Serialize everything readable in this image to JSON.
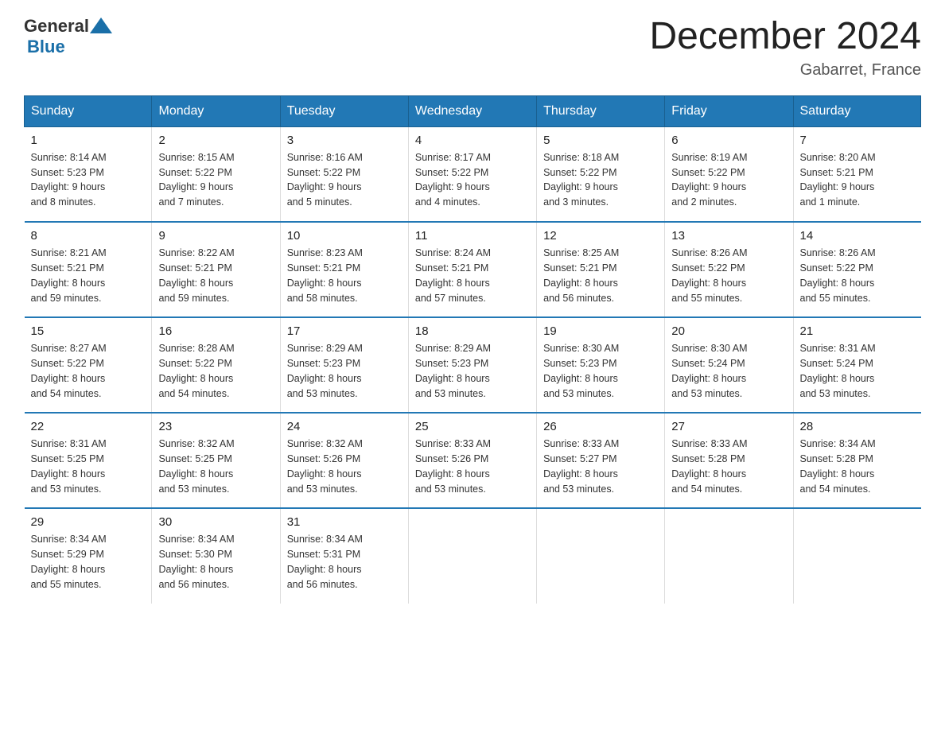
{
  "header": {
    "logo_general": "General",
    "logo_blue": "Blue",
    "month_title": "December 2024",
    "location": "Gabarret, France"
  },
  "days_of_week": [
    "Sunday",
    "Monday",
    "Tuesday",
    "Wednesday",
    "Thursday",
    "Friday",
    "Saturday"
  ],
  "weeks": [
    [
      {
        "day": "1",
        "sunrise": "8:14 AM",
        "sunset": "5:23 PM",
        "daylight": "9 hours and 8 minutes."
      },
      {
        "day": "2",
        "sunrise": "8:15 AM",
        "sunset": "5:22 PM",
        "daylight": "9 hours and 7 minutes."
      },
      {
        "day": "3",
        "sunrise": "8:16 AM",
        "sunset": "5:22 PM",
        "daylight": "9 hours and 5 minutes."
      },
      {
        "day": "4",
        "sunrise": "8:17 AM",
        "sunset": "5:22 PM",
        "daylight": "9 hours and 4 minutes."
      },
      {
        "day": "5",
        "sunrise": "8:18 AM",
        "sunset": "5:22 PM",
        "daylight": "9 hours and 3 minutes."
      },
      {
        "day": "6",
        "sunrise": "8:19 AM",
        "sunset": "5:22 PM",
        "daylight": "9 hours and 2 minutes."
      },
      {
        "day": "7",
        "sunrise": "8:20 AM",
        "sunset": "5:21 PM",
        "daylight": "9 hours and 1 minute."
      }
    ],
    [
      {
        "day": "8",
        "sunrise": "8:21 AM",
        "sunset": "5:21 PM",
        "daylight": "8 hours and 59 minutes."
      },
      {
        "day": "9",
        "sunrise": "8:22 AM",
        "sunset": "5:21 PM",
        "daylight": "8 hours and 59 minutes."
      },
      {
        "day": "10",
        "sunrise": "8:23 AM",
        "sunset": "5:21 PM",
        "daylight": "8 hours and 58 minutes."
      },
      {
        "day": "11",
        "sunrise": "8:24 AM",
        "sunset": "5:21 PM",
        "daylight": "8 hours and 57 minutes."
      },
      {
        "day": "12",
        "sunrise": "8:25 AM",
        "sunset": "5:21 PM",
        "daylight": "8 hours and 56 minutes."
      },
      {
        "day": "13",
        "sunrise": "8:26 AM",
        "sunset": "5:22 PM",
        "daylight": "8 hours and 55 minutes."
      },
      {
        "day": "14",
        "sunrise": "8:26 AM",
        "sunset": "5:22 PM",
        "daylight": "8 hours and 55 minutes."
      }
    ],
    [
      {
        "day": "15",
        "sunrise": "8:27 AM",
        "sunset": "5:22 PM",
        "daylight": "8 hours and 54 minutes."
      },
      {
        "day": "16",
        "sunrise": "8:28 AM",
        "sunset": "5:22 PM",
        "daylight": "8 hours and 54 minutes."
      },
      {
        "day": "17",
        "sunrise": "8:29 AM",
        "sunset": "5:23 PM",
        "daylight": "8 hours and 53 minutes."
      },
      {
        "day": "18",
        "sunrise": "8:29 AM",
        "sunset": "5:23 PM",
        "daylight": "8 hours and 53 minutes."
      },
      {
        "day": "19",
        "sunrise": "8:30 AM",
        "sunset": "5:23 PM",
        "daylight": "8 hours and 53 minutes."
      },
      {
        "day": "20",
        "sunrise": "8:30 AM",
        "sunset": "5:24 PM",
        "daylight": "8 hours and 53 minutes."
      },
      {
        "day": "21",
        "sunrise": "8:31 AM",
        "sunset": "5:24 PM",
        "daylight": "8 hours and 53 minutes."
      }
    ],
    [
      {
        "day": "22",
        "sunrise": "8:31 AM",
        "sunset": "5:25 PM",
        "daylight": "8 hours and 53 minutes."
      },
      {
        "day": "23",
        "sunrise": "8:32 AM",
        "sunset": "5:25 PM",
        "daylight": "8 hours and 53 minutes."
      },
      {
        "day": "24",
        "sunrise": "8:32 AM",
        "sunset": "5:26 PM",
        "daylight": "8 hours and 53 minutes."
      },
      {
        "day": "25",
        "sunrise": "8:33 AM",
        "sunset": "5:26 PM",
        "daylight": "8 hours and 53 minutes."
      },
      {
        "day": "26",
        "sunrise": "8:33 AM",
        "sunset": "5:27 PM",
        "daylight": "8 hours and 53 minutes."
      },
      {
        "day": "27",
        "sunrise": "8:33 AM",
        "sunset": "5:28 PM",
        "daylight": "8 hours and 54 minutes."
      },
      {
        "day": "28",
        "sunrise": "8:34 AM",
        "sunset": "5:28 PM",
        "daylight": "8 hours and 54 minutes."
      }
    ],
    [
      {
        "day": "29",
        "sunrise": "8:34 AM",
        "sunset": "5:29 PM",
        "daylight": "8 hours and 55 minutes."
      },
      {
        "day": "30",
        "sunrise": "8:34 AM",
        "sunset": "5:30 PM",
        "daylight": "8 hours and 56 minutes."
      },
      {
        "day": "31",
        "sunrise": "8:34 AM",
        "sunset": "5:31 PM",
        "daylight": "8 hours and 56 minutes."
      },
      null,
      null,
      null,
      null
    ]
  ],
  "labels": {
    "sunrise_prefix": "Sunrise: ",
    "sunset_prefix": "Sunset: ",
    "daylight_prefix": "Daylight: "
  }
}
